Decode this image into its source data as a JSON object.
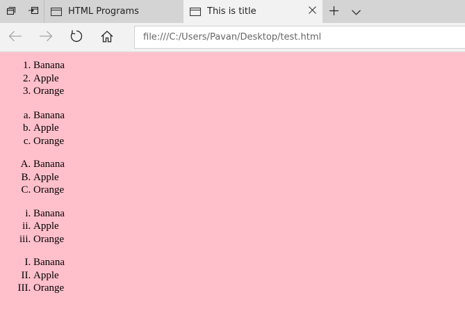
{
  "browser": {
    "tabs": [
      {
        "title": "HTML Programs",
        "active": false,
        "icon": "page-icon"
      },
      {
        "title": "This is title",
        "active": true,
        "icon": "page-icon"
      }
    ],
    "address": "file:///C:/Users/Pavan/Desktop/test.html",
    "icons": {
      "tab_preview": "tab-preview-icon",
      "tabs_aside": "set-tabs-aside-icon",
      "back": "back-arrow-icon",
      "forward": "forward-arrow-icon",
      "refresh": "refresh-icon",
      "home": "home-icon",
      "new_tab": "plus-icon",
      "tab_list": "chevron-down-icon",
      "close": "close-icon"
    }
  },
  "page": {
    "background": "#ffc0cb",
    "lists": [
      {
        "type": "decimal",
        "items": [
          "Banana",
          "Apple",
          "Orange"
        ]
      },
      {
        "type": "lower-alpha",
        "items": [
          "Banana",
          "Apple",
          "Orange"
        ]
      },
      {
        "type": "upper-alpha",
        "items": [
          "Banana",
          "Apple",
          "Orange"
        ]
      },
      {
        "type": "lower-roman",
        "items": [
          "Banana",
          "Apple",
          "Orange"
        ]
      },
      {
        "type": "upper-roman",
        "items": [
          "Banana",
          "Apple",
          "Orange"
        ]
      }
    ]
  }
}
